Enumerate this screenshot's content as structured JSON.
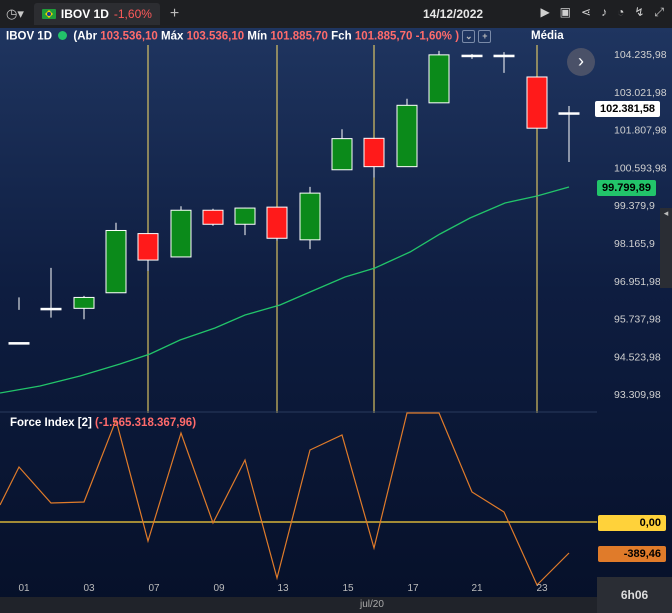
{
  "topbar": {
    "clock_icon": "clock-icon",
    "tab": {
      "symbol": "IBOV 1D",
      "change": "-1,60%"
    },
    "new_tab": "+",
    "date": "14/12/2022",
    "icons": [
      "play-icon",
      "briefcase-icon",
      "share-icon",
      "bell-icon",
      "clock-check-icon",
      "chart-icon",
      "fullscreen-icon"
    ]
  },
  "info": {
    "symbol": "IBOV 1D",
    "abr_label": "(Abr",
    "abr": "103.536,10",
    "max_label": "Máx",
    "max": "103.536,10",
    "min_label": "Mín",
    "min": "101.885,70",
    "fch_label": "Fch",
    "fch": "101.885,70 -1,60% )",
    "media_label": "Média"
  },
  "price_axis": {
    "labels": [
      "104.235,98",
      "103.021,98",
      "101.807,98",
      "100.593,98",
      "99.379,9",
      "98.165,9",
      "96.951,98",
      "95.737,98",
      "94.523,98",
      "93.309,98"
    ],
    "last_price": "102.381,58",
    "ma_price": "99.799,89"
  },
  "force_index": {
    "title": "Force Index [2]",
    "value": "(-1.565.318.367,96)",
    "zero_label": "0,00",
    "current_label": "-389,46"
  },
  "x_axis": {
    "labels": [
      "01",
      "03",
      "07",
      "09",
      "13",
      "15",
      "17",
      "21",
      "23"
    ],
    "month": "jul/20"
  },
  "timeframe": "6h06",
  "colors": {
    "up": "#0b8a1a",
    "down": "#ff1a1a",
    "ma": "#22c46a",
    "vline": "#ffe066",
    "fi": "#e07b2a",
    "zero": "#ffd23a"
  },
  "chart_data": {
    "type": "candlestick",
    "categories": [
      "c1",
      "c2",
      "c3",
      "c4",
      "c5",
      "c6",
      "c7",
      "c8",
      "c9",
      "c10",
      "c11",
      "c12",
      "c13",
      "c14",
      "c15",
      "c16",
      "c17"
    ],
    "ohlc": [
      [
        95000,
        96450,
        96050,
        94950
      ],
      [
        96100,
        97400,
        95800,
        96100
      ],
      [
        96100,
        96500,
        95750,
        96450
      ],
      [
        96600,
        98850,
        96600,
        98600
      ],
      [
        98500,
        98500,
        97300,
        97650
      ],
      [
        97750,
        99380,
        97750,
        99250
      ],
      [
        99250,
        99300,
        98750,
        98800
      ],
      [
        98800,
        99330,
        98450,
        99320
      ],
      [
        99350,
        99350,
        98280,
        98350
      ],
      [
        98300,
        100000,
        98000,
        99800
      ],
      [
        100550,
        101850,
        100550,
        101550
      ],
      [
        101560,
        101560,
        100300,
        100650
      ],
      [
        100650,
        102830,
        100650,
        102620
      ],
      [
        102700,
        104370,
        102700,
        104240
      ],
      [
        104230,
        104270,
        104110,
        104200
      ],
      [
        104230,
        104330,
        103660,
        104180
      ],
      [
        103530,
        103540,
        101885,
        101885
      ],
      [
        102380,
        102600,
        100800,
        102380
      ]
    ],
    "ylim": [
      93000,
      104900
    ]
  }
}
